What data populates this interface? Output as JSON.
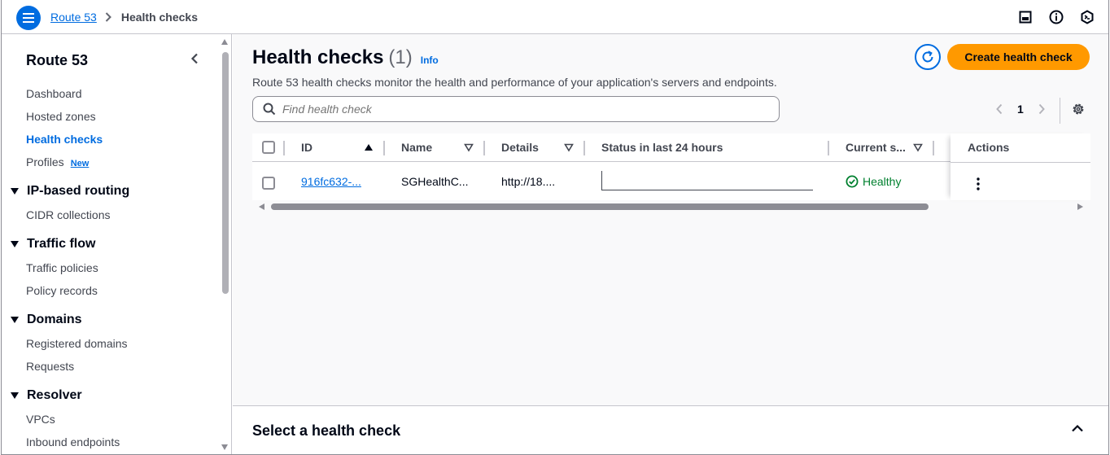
{
  "topbar": {
    "breadcrumb": {
      "service": "Route 53",
      "current": "Health checks"
    },
    "icons": [
      "menu-icon",
      "notifications-panel-icon",
      "info-icon",
      "cloud-shell-icon"
    ]
  },
  "sidebar": {
    "title": "Route 53",
    "items": {
      "dashboard": "Dashboard",
      "hosted_zones": "Hosted zones",
      "health_checks": "Health checks",
      "profiles": "Profiles",
      "profiles_badge": "New"
    },
    "sections": {
      "ip_routing": {
        "title": "IP-based routing",
        "items": [
          "CIDR collections"
        ]
      },
      "traffic_flow": {
        "title": "Traffic flow",
        "items": [
          "Traffic policies",
          "Policy records"
        ]
      },
      "domains": {
        "title": "Domains",
        "items": [
          "Registered domains",
          "Requests"
        ]
      },
      "resolver": {
        "title": "Resolver",
        "items": [
          "VPCs",
          "Inbound endpoints"
        ]
      }
    }
  },
  "main": {
    "title": "Health checks",
    "count": "(1)",
    "info": "Info",
    "description": "Route 53 health checks monitor the health and performance of your application's servers and endpoints.",
    "create_button": "Create health check",
    "search_placeholder": "Find health check",
    "pagination": {
      "page": "1"
    }
  },
  "table": {
    "columns": {
      "id": "ID",
      "name": "Name",
      "details": "Details",
      "status24": "Status in last 24 hours",
      "current": "Current s...",
      "actions": "Actions"
    },
    "rows": [
      {
        "id": "916fc632-...",
        "name": "SGHealthC...",
        "details": "http://18....",
        "current_status": "Healthy"
      }
    ]
  },
  "split_panel": {
    "title": "Select a health check"
  },
  "colors": {
    "accent": "#006ce0",
    "primary_button": "#ff9900",
    "healthy": "#00802f"
  }
}
